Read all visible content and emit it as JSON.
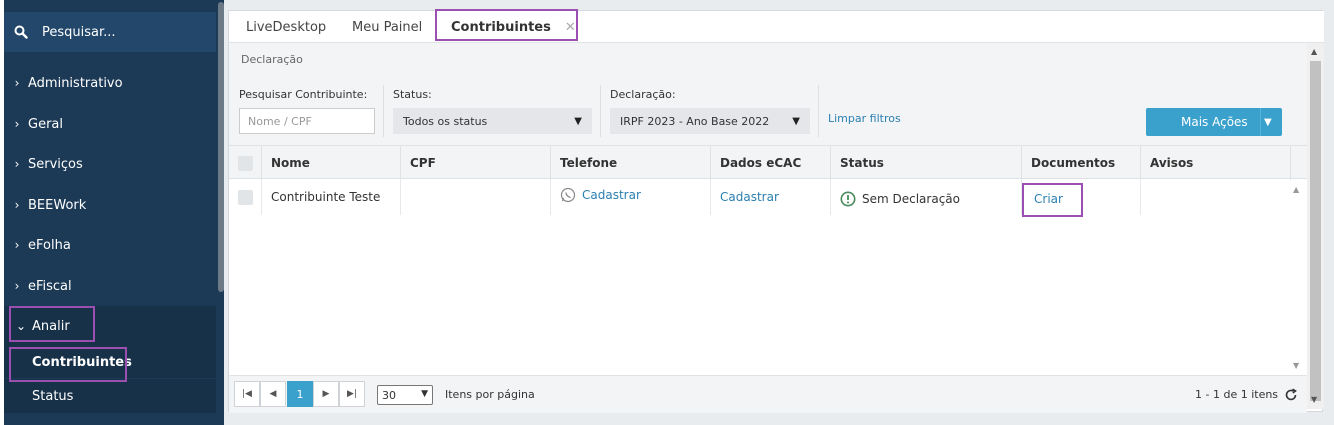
{
  "sidebar": {
    "search_label": "Pesquisar...",
    "items": [
      {
        "label": "Administrativo"
      },
      {
        "label": "Geral"
      },
      {
        "label": "Serviços"
      },
      {
        "label": "BEEWork"
      },
      {
        "label": "eFolha"
      },
      {
        "label": "eFiscal"
      },
      {
        "label": "Analir"
      }
    ],
    "subitems": [
      {
        "label": "Contribuintes"
      },
      {
        "label": "Status"
      }
    ]
  },
  "tabs": [
    {
      "label": "LiveDesktop"
    },
    {
      "label": "Meu Painel"
    },
    {
      "label": "Contribuintes",
      "close": "✕"
    }
  ],
  "breadcrumb": "Declaração",
  "filters": {
    "search_label": "Pesquisar Contribuinte:",
    "search_placeholder": "Nome / CPF",
    "status_label": "Status:",
    "status_value": "Todos os status",
    "declaracao_label": "Declaração:",
    "declaracao_value": "IRPF 2023 - Ano Base 2022",
    "clear_label": "Limpar filtros",
    "more_actions": "Mais Ações"
  },
  "grid": {
    "columns": [
      "Nome",
      "CPF",
      "Telefone",
      "Dados eCAC",
      "Status",
      "Documentos",
      "Avisos"
    ],
    "rows": [
      {
        "nome": "Contribuinte Teste",
        "cpf": "",
        "telefone": "Cadastrar",
        "dados_ecac": "Cadastrar",
        "status": "Sem Declaração",
        "documentos": "Criar",
        "avisos": ""
      }
    ]
  },
  "pager": {
    "current_page": "1",
    "per_page": "30",
    "per_page_label": "Itens por página",
    "summary": "1 - 1 de 1 itens"
  },
  "colors": {
    "sidebar_bg": "#1c3a56",
    "accent": "#3aa1cc",
    "link": "#2b7fb0",
    "highlight": "#9b4fb0"
  }
}
